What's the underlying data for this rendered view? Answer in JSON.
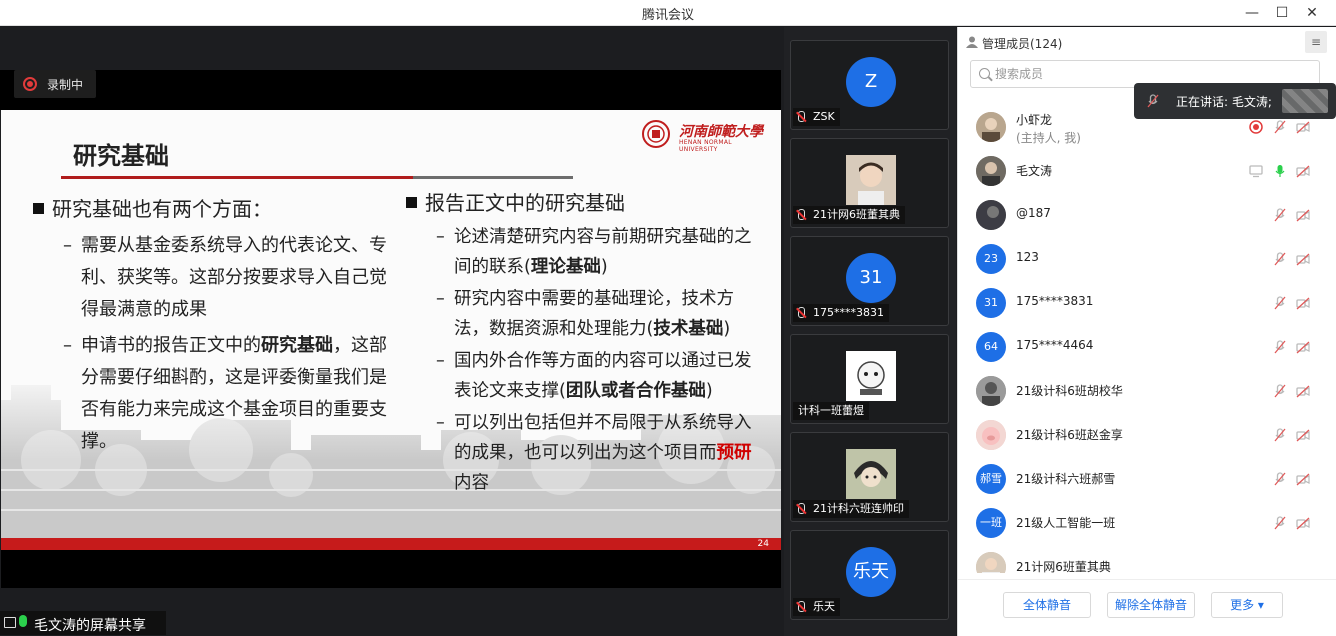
{
  "window": {
    "title": "腾讯会议"
  },
  "recording": {
    "label": "录制中"
  },
  "slide": {
    "title": "研究基础",
    "logo_cn": "河南師範大學",
    "logo_en": "HENAN NORMAL UNIVERSITY",
    "page_number": "24",
    "left_heading": "研究基础也有两个方面：",
    "left_item1": "需要从基金委系统导入的代表论文、专利、获奖等。这部分按要求导入自己觉得最满意的成果",
    "left_item2_a": "申请书的报告正文中的",
    "left_item2_b": "研究基础",
    "left_item2_c": "，这部分需要仔细斟酌，这是评委衡量我们是否有能力来完成这个基金项目的重要支撑。",
    "right_heading": "报告正文中的研究基础",
    "right_item1_a": "论述清楚研究内容与前期研究基础的之间的联系(",
    "right_item1_b": "理论基础",
    "right_item1_c": ")",
    "right_item2_a": "研究内容中需要的基础理论，技术方法，数据资源和处理能力(",
    "right_item2_b": "技术基础",
    "right_item2_c": ")",
    "right_item3_a": "国内外合作等方面的内容可以通过已发表论文来支撑(",
    "right_item3_b": "团队或者合作基础",
    "right_item3_c": ")",
    "right_item4_a": "可以列出包括但并不局限于从系统导入的成果，也可以列出为这个项目而",
    "right_item4_b": "预研",
    "right_item4_c": "内容"
  },
  "screen_share": {
    "label": "毛文涛的屏幕共享"
  },
  "tiles": [
    {
      "avatar": "Z",
      "name": "ZSK"
    },
    {
      "avatar": "",
      "name": "21计网6班董其典"
    },
    {
      "avatar": "31",
      "name": "175****3831"
    },
    {
      "avatar": "",
      "name": "计科一班蕾煜"
    },
    {
      "avatar": "",
      "name": "21计科六班连帅印"
    },
    {
      "avatar": "乐天",
      "name": "乐天"
    }
  ],
  "panel": {
    "title": "管理成员(124)",
    "search_placeholder": "搜索成员",
    "members": [
      {
        "avatar": "",
        "name": "小虾龙",
        "sub": "(主持人, 我)"
      },
      {
        "avatar": "",
        "name": "毛文涛"
      },
      {
        "avatar": "",
        "name": "@187"
      },
      {
        "avatar": "23",
        "name": "123"
      },
      {
        "avatar": "31",
        "name": "175****3831"
      },
      {
        "avatar": "64",
        "name": "175****4464"
      },
      {
        "avatar": "",
        "name": "21级计科6班胡校华"
      },
      {
        "avatar": "",
        "name": "21级计科6班赵金享"
      },
      {
        "avatar": "郝雪",
        "name": "21级计科六班郝雪"
      },
      {
        "avatar": "一班",
        "name": "21级人工智能一班"
      },
      {
        "avatar": "",
        "name": "21计网6班董其典"
      }
    ],
    "mute_all": "全体静音",
    "unmute_all": "解除全体静音",
    "more": "更多 ▾"
  },
  "speaking": {
    "label": "正在讲话: 毛文涛;"
  },
  "colors": {
    "accent": "#1e6fe6",
    "slide_red": "#c61b1b",
    "mic_on": "#2bd04c",
    "record": "#e23b3b"
  }
}
